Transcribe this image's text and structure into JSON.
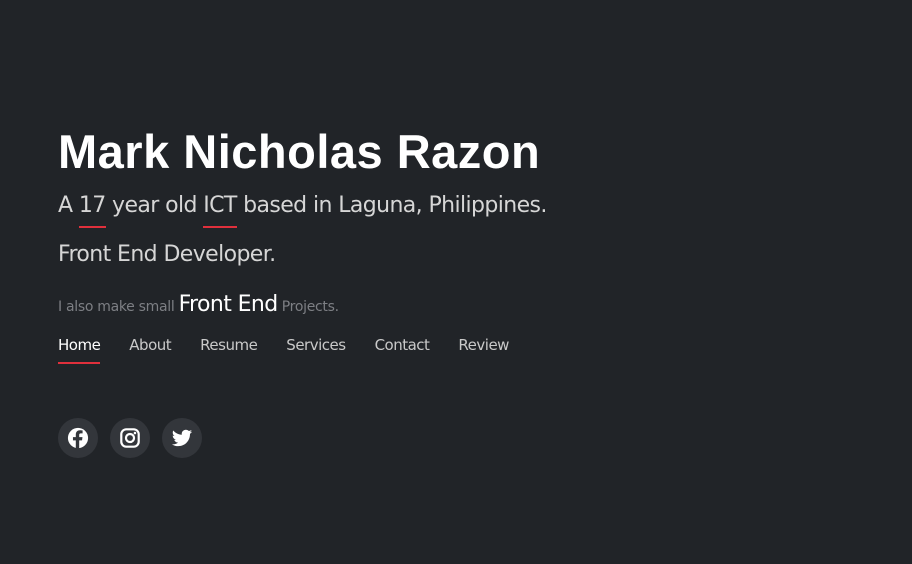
{
  "hero": {
    "name": "Mark Nicholas Razon",
    "tagline": {
      "prefix": "A ",
      "age": "17",
      "mid": " year old ",
      "field": "ICT",
      "suffix": " based in Laguna, Philippines."
    },
    "role": "Front End Developer.",
    "projects": {
      "prefix": "I also make small ",
      "highlight": "Front End",
      "suffix": " Projects."
    }
  },
  "nav": {
    "items": [
      "Home",
      "About",
      "Resume",
      "Services",
      "Contact",
      "Review"
    ],
    "active": "Home"
  },
  "socials": [
    {
      "icon": "facebook-icon"
    },
    {
      "icon": "instagram-icon"
    },
    {
      "icon": "twitter-icon"
    }
  ],
  "colors": {
    "background": "#212428",
    "accent": "#e0303c",
    "text": "#d6d6d6",
    "muted": "#7d7f84"
  }
}
